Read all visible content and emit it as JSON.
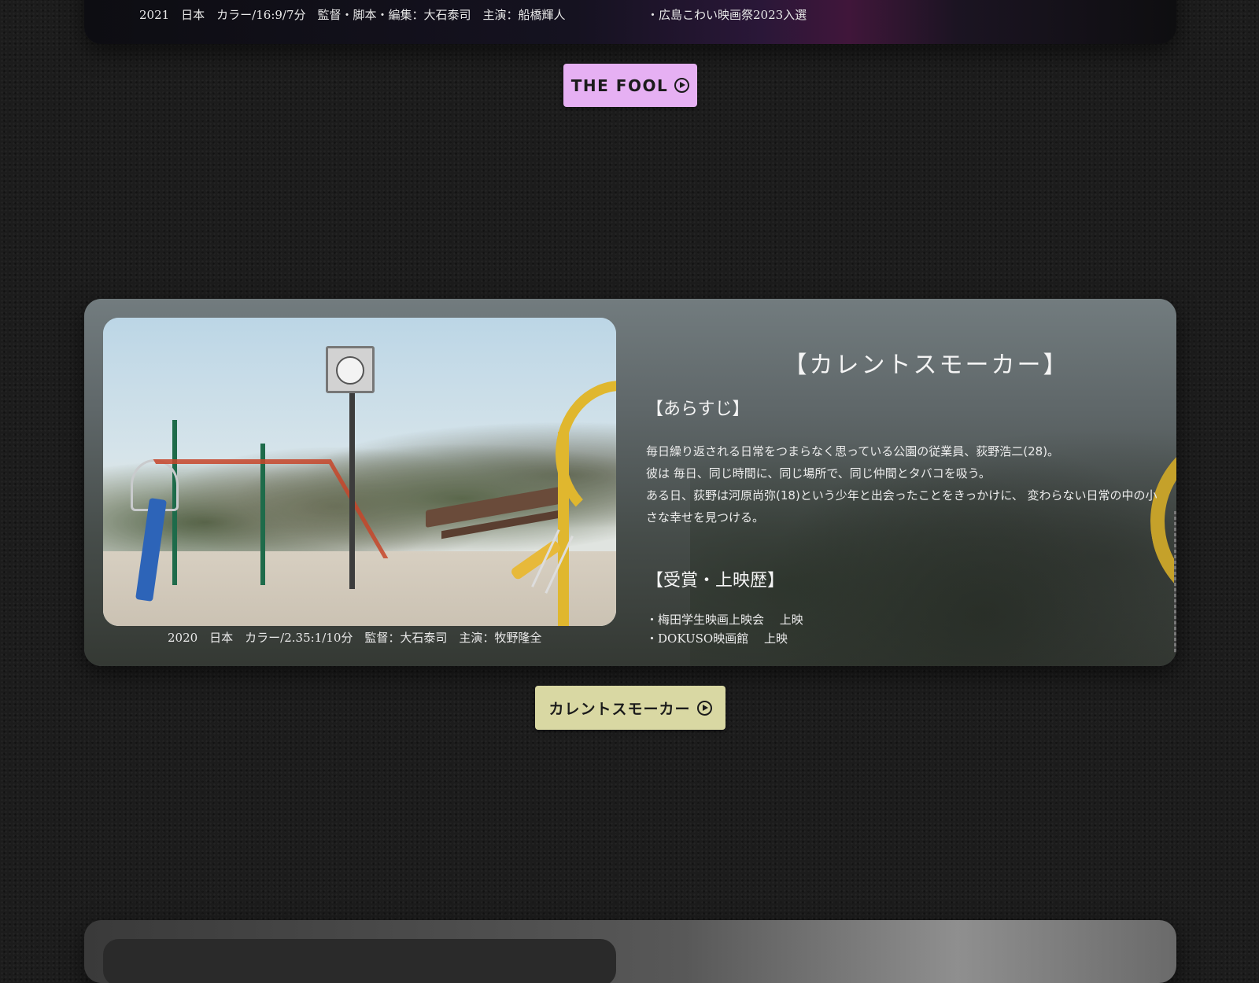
{
  "previous_work": {
    "meta": "2021　日本　カラー/16:9/7分　監督・脚本・編集：大石泰司　主演：船橋輝人",
    "award_line": "・広島こわい映画祭2023入選",
    "button_label": "THE FOOL",
    "button_color": "#e6b0f3"
  },
  "current_work": {
    "title": "【カレントスモーカー】",
    "synopsis_heading": "【あらすじ】",
    "synopsis_lines": [
      "毎日繰り返される日常をつまらなく思っている公園の従業員、荻野浩二(28)。",
      "彼は 毎日、同じ時間に、同じ場所で、同じ仲間とタバコを吸う。",
      "ある日、荻野は河原尚弥(18)という少年と出会ったことをきっかけに、 変わらない日常の中の小さな幸せを見つける。"
    ],
    "awards_heading": "【受賞・上映歴】",
    "awards": [
      "・梅田学生映画上映会　 上映",
      "・DOKUSO映画館　 上映"
    ],
    "meta": "2020　日本　カラー/2.35:1/10分　監督：大石泰司　主演：牧野隆全",
    "button_label": "カレントスモーカー",
    "button_color": "#d9d8a3",
    "photo_icon": "playground-photo"
  },
  "icons": {
    "play": "play-circle-icon"
  }
}
